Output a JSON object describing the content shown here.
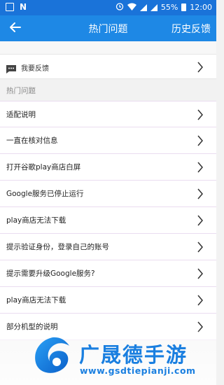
{
  "status_bar": {
    "battery": "55%",
    "time": "12:00",
    "n_label": "N"
  },
  "header": {
    "title": "热门问题",
    "history_label": "历史反馈"
  },
  "feedback": {
    "label": "我要反馈"
  },
  "section": {
    "label": "热门问题"
  },
  "items": [
    {
      "label": "适配说明"
    },
    {
      "label": "一直在核对信息"
    },
    {
      "label": "打开谷歌play商店白屏"
    },
    {
      "label": "Google服务已停止运行"
    },
    {
      "label": "play商店无法下载"
    },
    {
      "label": "提示验证身份，登录自己的账号"
    },
    {
      "label": "提示需要升级Google服务?"
    },
    {
      "label": "play商店无法下载"
    },
    {
      "label": "部分机型的说明"
    }
  ],
  "watermark": {
    "brand": "广晟德手游",
    "url": "www.gsdtiepianji.com"
  },
  "colors": {
    "status_bar": "#1a73d9",
    "app_bar": "#1e88e5",
    "watermark": "#1a7fe0"
  }
}
